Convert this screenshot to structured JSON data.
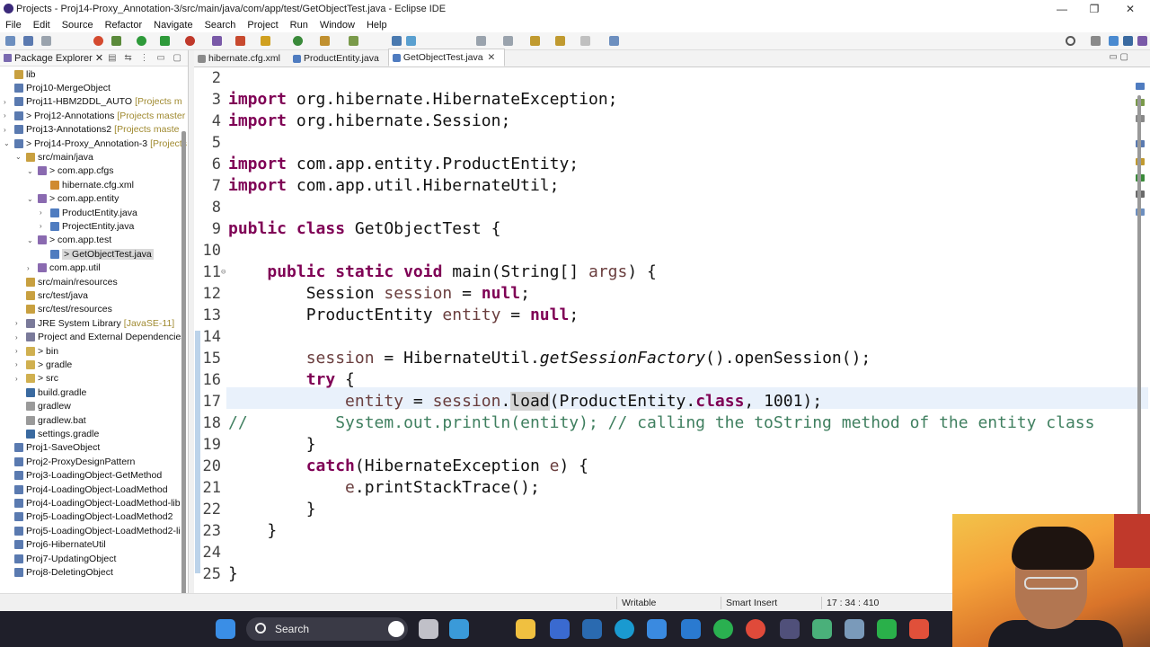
{
  "window": {
    "title": "Projects - Proj14-Proxy_Annotation-3/src/main/java/com/app/test/GetObjectTest.java - Eclipse IDE",
    "min": "—",
    "max": "❐",
    "close": "✕"
  },
  "menu": [
    "File",
    "Edit",
    "Source",
    "Refactor",
    "Navigate",
    "Search",
    "Project",
    "Run",
    "Window",
    "Help"
  ],
  "package_explorer": {
    "title": "Package Explorer",
    "items": [
      {
        "label": "lib",
        "deco": "",
        "selected": false
      },
      {
        "label": "Proj10-MergeObject",
        "deco": "",
        "selected": false
      },
      {
        "label": "Proj11-HBM2DDL_AUTO",
        "deco": "[Projects m",
        "selected": false
      },
      {
        "label": "> Proj12-Annotations",
        "deco": "[Projects master",
        "selected": false
      },
      {
        "label": "Proj13-Annotations2",
        "deco": "[Projects maste",
        "selected": false
      },
      {
        "label": "> Proj14-Proxy_Annotation-3",
        "deco": "[Projects",
        "selected": false
      },
      {
        "label": "src/main/java",
        "deco": "",
        "selected": false
      },
      {
        "label": "> com.app.cfgs",
        "deco": "",
        "selected": false
      },
      {
        "label": "hibernate.cfg.xml",
        "deco": "",
        "selected": false
      },
      {
        "label": "> com.app.entity",
        "deco": "",
        "selected": false
      },
      {
        "label": "ProductEntity.java",
        "deco": "",
        "selected": false
      },
      {
        "label": "ProjectEntity.java",
        "deco": "",
        "selected": false
      },
      {
        "label": "> com.app.test",
        "deco": "",
        "selected": false
      },
      {
        "label": "> GetObjectTest.java",
        "deco": "",
        "selected": true
      },
      {
        "label": "com.app.util",
        "deco": "",
        "selected": false
      },
      {
        "label": "src/main/resources",
        "deco": "",
        "selected": false
      },
      {
        "label": "src/test/java",
        "deco": "",
        "selected": false
      },
      {
        "label": "src/test/resources",
        "deco": "",
        "selected": false
      },
      {
        "label": "JRE System Library",
        "deco": "[JavaSE-11]",
        "selected": false
      },
      {
        "label": "Project and External Dependencies",
        "deco": "",
        "selected": false
      },
      {
        "label": "> bin",
        "deco": "",
        "selected": false
      },
      {
        "label": "> gradle",
        "deco": "",
        "selected": false
      },
      {
        "label": "> src",
        "deco": "",
        "selected": false
      },
      {
        "label": "build.gradle",
        "deco": "",
        "selected": false
      },
      {
        "label": "gradlew",
        "deco": "",
        "selected": false
      },
      {
        "label": "gradlew.bat",
        "deco": "",
        "selected": false
      },
      {
        "label": "settings.gradle",
        "deco": "",
        "selected": false
      },
      {
        "label": "Proj1-SaveObject",
        "deco": "",
        "selected": false
      },
      {
        "label": "Proj2-ProxyDesignPattern",
        "deco": "",
        "selected": false
      },
      {
        "label": "Proj3-LoadingObject-GetMethod",
        "deco": "",
        "selected": false
      },
      {
        "label": "Proj4-LoadingObject-LoadMethod",
        "deco": "",
        "selected": false
      },
      {
        "label": "Proj4-LoadingObject-LoadMethod-lib",
        "deco": "",
        "selected": false
      },
      {
        "label": "Proj5-LoadingObject-LoadMethod2",
        "deco": "",
        "selected": false
      },
      {
        "label": "Proj5-LoadingObject-LoadMethod2-li",
        "deco": "",
        "selected": false
      },
      {
        "label": "Proj6-HibernateUtil",
        "deco": "",
        "selected": false
      },
      {
        "label": "Proj7-UpdatingObject",
        "deco": "",
        "selected": false
      },
      {
        "label": "Proj8-DeletingObject",
        "deco": "",
        "selected": false
      }
    ]
  },
  "editor": {
    "tabs": [
      {
        "label": "hibernate.cfg.xml",
        "active": false
      },
      {
        "label": "ProductEntity.java",
        "active": false
      },
      {
        "label": "GetObjectTest.java",
        "active": true
      }
    ],
    "line_numbers": [
      "2",
      "3",
      "4",
      "5",
      "6",
      "7",
      "8",
      "9",
      "10",
      "11",
      "12",
      "13",
      "14",
      "15",
      "16",
      "17",
      "18",
      "19",
      "20",
      "21",
      "22",
      "23",
      "24",
      "25"
    ]
  },
  "status": {
    "writable": "Writable",
    "insert_mode": "Smart Insert",
    "position": "17 : 34 : 410"
  },
  "taskbar": {
    "search_label": "Search"
  }
}
